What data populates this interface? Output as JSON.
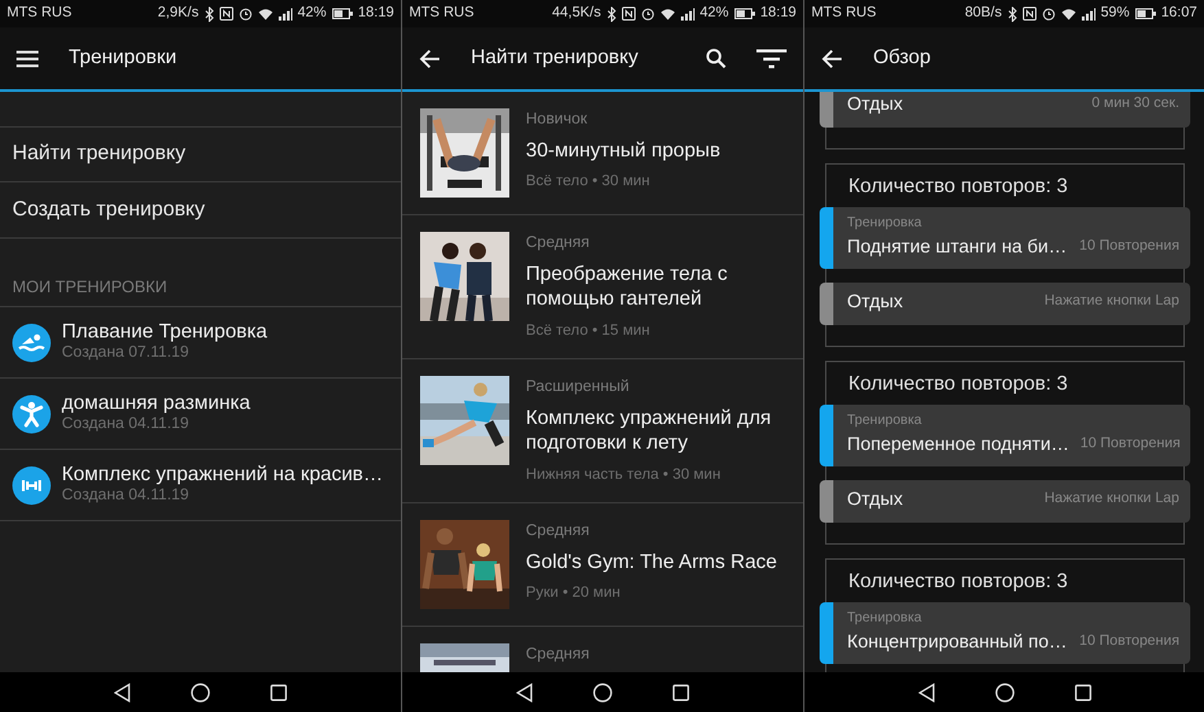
{
  "home_screen": {
    "status_bar": {
      "carrier": "MTS RUS",
      "speed": "2,9K/s",
      "battery": "42%",
      "time": "18:19"
    },
    "title": "Тренировки",
    "menu_items": [
      "Найти тренировку",
      "Создать тренировку"
    ],
    "section_header": "МОИ ТРЕНИРОВКИ",
    "workouts": [
      {
        "name": "Плавание Тренировка",
        "created": "Создана 07.11.19"
      },
      {
        "name": "домашняя разминка",
        "created": "Создана 04.11.19"
      },
      {
        "name": "Комплекс упражнений на красив…",
        "created": "Создана 04.11.19"
      }
    ]
  },
  "find_screen": {
    "status_bar": {
      "carrier": "MTS RUS",
      "speed": "44,5K/s",
      "battery": "42%",
      "time": "18:19"
    },
    "title": "Найти тренировку",
    "workouts": [
      {
        "difficulty": "Новичок",
        "title": "30-минутный прорыв",
        "meta": "Всё тело • 30 мин"
      },
      {
        "difficulty": "Средняя",
        "title": "Преображение тела с помощью гантелей",
        "meta": "Всё тело • 15 мин"
      },
      {
        "difficulty": "Расширенный",
        "title": "Комплекс упражнений для подготовки к лету",
        "meta": "Нижняя часть тела • 30 мин"
      },
      {
        "difficulty": "Средняя",
        "title": "Gold's Gym: The Arms Race",
        "meta": "Руки • 20 мин"
      },
      {
        "difficulty": "Средняя"
      }
    ]
  },
  "overview_screen": {
    "status_bar": {
      "carrier": "MTS RUS",
      "speed": "80B/s",
      "battery": "59%",
      "time": "16:07"
    },
    "title": "Обзор",
    "groups": [
      {
        "steps": [
          {
            "kind": "rest",
            "name": "Отдых",
            "detail": "0 мин 30 сек."
          }
        ]
      },
      {
        "heading": "Количество повторов: 3",
        "steps": [
          {
            "kind": "exercise",
            "label": "Тренировка",
            "name": "Поднятие штанги на би…",
            "detail": "10 Повторения"
          },
          {
            "kind": "rest",
            "name": "Отдых",
            "detail": "Нажатие кнопки Lap"
          }
        ]
      },
      {
        "heading": "Количество повторов: 3",
        "steps": [
          {
            "kind": "exercise",
            "label": "Тренировка",
            "name": "Попеременное подняти…",
            "detail": "10 Повторения"
          },
          {
            "kind": "rest",
            "name": "Отдых",
            "detail": "Нажатие кнопки Lap"
          }
        ]
      },
      {
        "heading": "Количество повторов: 3",
        "steps": [
          {
            "kind": "exercise",
            "label": "Тренировка",
            "name": "Концентрированный по…",
            "detail": "10 Повторения"
          }
        ]
      }
    ]
  }
}
